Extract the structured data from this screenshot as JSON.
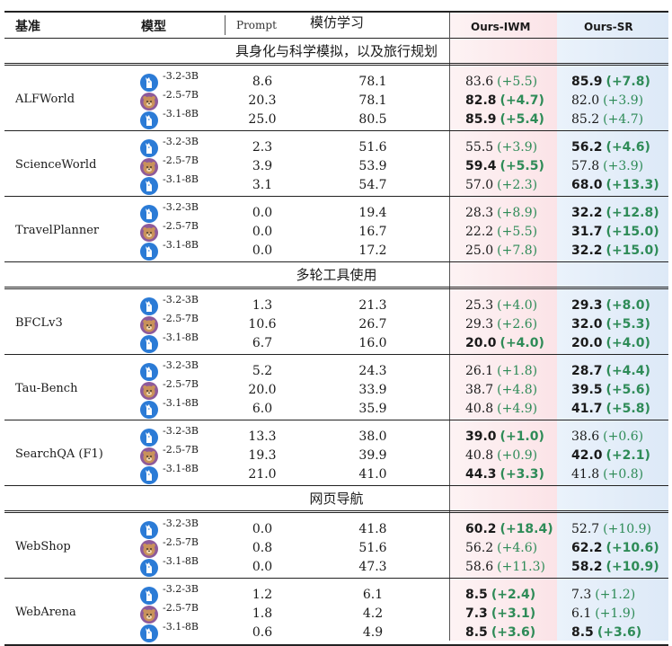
{
  "header": {
    "col_benchmark": "基准",
    "col_model": "模型",
    "col_prompt": "Prompt",
    "col_imitation": "模仿学习",
    "col_ours_iwm": "Ours-IWM",
    "col_ours_sr": "Ours-SR"
  },
  "colors": {
    "iwm_bg": "#fbe3e7",
    "sr_bg": "#dde9f7",
    "gain_text": "#2e8b57",
    "llama_icon": "#2b7bd6",
    "qwen_icon": "#8e5a9a"
  },
  "icons": {
    "llama": "llama-icon",
    "qwen": "bear-icon"
  },
  "sections": [
    {
      "title": "具身化与科学模拟，以及旅行规划",
      "benchmarks": [
        {
          "name": "ALFWorld",
          "rows": [
            {
              "model": "-3.2-3B",
              "icon": "llama",
              "prompt": "8.6",
              "imitation": "78.1",
              "iwm": "83.6",
              "iwm_gain": "(+5.5)",
              "iwm_bold": false,
              "sr": "85.9",
              "sr_gain": "(+7.8)",
              "sr_bold": true
            },
            {
              "model": "-2.5-7B",
              "icon": "qwen",
              "prompt": "20.3",
              "imitation": "78.1",
              "iwm": "82.8",
              "iwm_gain": "(+4.7)",
              "iwm_bold": true,
              "sr": "82.0",
              "sr_gain": "(+3.9)",
              "sr_bold": false
            },
            {
              "model": "-3.1-8B",
              "icon": "llama",
              "prompt": "25.0",
              "imitation": "80.5",
              "iwm": "85.9",
              "iwm_gain": "(+5.4)",
              "iwm_bold": true,
              "sr": "85.2",
              "sr_gain": "(+4.7)",
              "sr_bold": false
            }
          ]
        },
        {
          "name": "ScienceWorld",
          "rows": [
            {
              "model": "-3.2-3B",
              "icon": "llama",
              "prompt": "2.3",
              "imitation": "51.6",
              "iwm": "55.5",
              "iwm_gain": "(+3.9)",
              "iwm_bold": false,
              "sr": "56.2",
              "sr_gain": "(+4.6)",
              "sr_bold": true
            },
            {
              "model": "-2.5-7B",
              "icon": "qwen",
              "prompt": "3.9",
              "imitation": "53.9",
              "iwm": "59.4",
              "iwm_gain": "(+5.5)",
              "iwm_bold": true,
              "sr": "57.8",
              "sr_gain": "(+3.9)",
              "sr_bold": false
            },
            {
              "model": "-3.1-8B",
              "icon": "llama",
              "prompt": "3.1",
              "imitation": "54.7",
              "iwm": "57.0",
              "iwm_gain": "(+2.3)",
              "iwm_bold": false,
              "sr": "68.0",
              "sr_gain": "(+13.3)",
              "sr_bold": true
            }
          ]
        },
        {
          "name": "TravelPlanner",
          "rows": [
            {
              "model": "-3.2-3B",
              "icon": "llama",
              "prompt": "0.0",
              "imitation": "19.4",
              "iwm": "28.3",
              "iwm_gain": "(+8.9)",
              "iwm_bold": false,
              "sr": "32.2",
              "sr_gain": "(+12.8)",
              "sr_bold": true
            },
            {
              "model": "-2.5-7B",
              "icon": "qwen",
              "prompt": "0.0",
              "imitation": "16.7",
              "iwm": "22.2",
              "iwm_gain": "(+5.5)",
              "iwm_bold": false,
              "sr": "31.7",
              "sr_gain": "(+15.0)",
              "sr_bold": true
            },
            {
              "model": "-3.1-8B",
              "icon": "llama",
              "prompt": "0.0",
              "imitation": "17.2",
              "iwm": "25.0",
              "iwm_gain": "(+7.8)",
              "iwm_bold": false,
              "sr": "32.2",
              "sr_gain": "(+15.0)",
              "sr_bold": true
            }
          ]
        }
      ]
    },
    {
      "title": "多轮工具使用",
      "benchmarks": [
        {
          "name": "BFCLv3",
          "rows": [
            {
              "model": "-3.2-3B",
              "icon": "llama",
              "prompt": "1.3",
              "imitation": "21.3",
              "iwm": "25.3",
              "iwm_gain": "(+4.0)",
              "iwm_bold": false,
              "sr": "29.3",
              "sr_gain": "(+8.0)",
              "sr_bold": true
            },
            {
              "model": "-2.5-7B",
              "icon": "qwen",
              "prompt": "10.6",
              "imitation": "26.7",
              "iwm": "29.3",
              "iwm_gain": "(+2.6)",
              "iwm_bold": false,
              "sr": "32.0",
              "sr_gain": "(+5.3)",
              "sr_bold": true
            },
            {
              "model": "-3.1-8B",
              "icon": "llama",
              "prompt": "6.7",
              "imitation": "16.0",
              "iwm": "20.0",
              "iwm_gain": "(+4.0)",
              "iwm_bold": true,
              "sr": "20.0",
              "sr_gain": "(+4.0)",
              "sr_bold": true
            }
          ]
        },
        {
          "name": "Tau-Bench",
          "rows": [
            {
              "model": "-3.2-3B",
              "icon": "llama",
              "prompt": "5.2",
              "imitation": "24.3",
              "iwm": "26.1",
              "iwm_gain": "(+1.8)",
              "iwm_bold": false,
              "sr": "28.7",
              "sr_gain": "(+4.4)",
              "sr_bold": true
            },
            {
              "model": "-2.5-7B",
              "icon": "qwen",
              "prompt": "20.0",
              "imitation": "33.9",
              "iwm": "38.7",
              "iwm_gain": "(+4.8)",
              "iwm_bold": false,
              "sr": "39.5",
              "sr_gain": "(+5.6)",
              "sr_bold": true
            },
            {
              "model": "-3.1-8B",
              "icon": "llama",
              "prompt": "6.0",
              "imitation": "35.9",
              "iwm": "40.8",
              "iwm_gain": "(+4.9)",
              "iwm_bold": false,
              "sr": "41.7",
              "sr_gain": "(+5.8)",
              "sr_bold": true
            }
          ]
        },
        {
          "name": "SearchQA (F1)",
          "rows": [
            {
              "model": "-3.2-3B",
              "icon": "llama",
              "prompt": "13.3",
              "imitation": "38.0",
              "iwm": "39.0",
              "iwm_gain": "(+1.0)",
              "iwm_bold": true,
              "sr": "38.6",
              "sr_gain": "(+0.6)",
              "sr_bold": false
            },
            {
              "model": "-2.5-7B",
              "icon": "qwen",
              "prompt": "19.3",
              "imitation": "39.9",
              "iwm": "40.8",
              "iwm_gain": "(+0.9)",
              "iwm_bold": false,
              "sr": "42.0",
              "sr_gain": "(+2.1)",
              "sr_bold": true
            },
            {
              "model": "-3.1-8B",
              "icon": "llama",
              "prompt": "21.0",
              "imitation": "41.0",
              "iwm": "44.3",
              "iwm_gain": "(+3.3)",
              "iwm_bold": true,
              "sr": "41.8",
              "sr_gain": "(+0.8)",
              "sr_bold": false
            }
          ]
        }
      ]
    },
    {
      "title": "网页导航",
      "benchmarks": [
        {
          "name": "WebShop",
          "rows": [
            {
              "model": "-3.2-3B",
              "icon": "llama",
              "prompt": "0.0",
              "imitation": "41.8",
              "iwm": "60.2",
              "iwm_gain": "(+18.4)",
              "iwm_bold": true,
              "sr": "52.7",
              "sr_gain": "(+10.9)",
              "sr_bold": false
            },
            {
              "model": "-2.5-7B",
              "icon": "qwen",
              "prompt": "0.8",
              "imitation": "51.6",
              "iwm": "56.2",
              "iwm_gain": "(+4.6)",
              "iwm_bold": false,
              "sr": "62.2",
              "sr_gain": "(+10.6)",
              "sr_bold": true
            },
            {
              "model": "-3.1-8B",
              "icon": "llama",
              "prompt": "0.0",
              "imitation": "47.3",
              "iwm": "58.6",
              "iwm_gain": "(+11.3)",
              "iwm_bold": false,
              "sr": "58.2",
              "sr_gain": "(+10.9)",
              "sr_bold": true
            }
          ]
        },
        {
          "name": "WebArena",
          "rows": [
            {
              "model": "-3.2-3B",
              "icon": "llama",
              "prompt": "1.2",
              "imitation": "6.1",
              "iwm": "8.5",
              "iwm_gain": "(+2.4)",
              "iwm_bold": true,
              "sr": "7.3",
              "sr_gain": "(+1.2)",
              "sr_bold": false
            },
            {
              "model": "-2.5-7B",
              "icon": "qwen",
              "prompt": "1.8",
              "imitation": "4.2",
              "iwm": "7.3",
              "iwm_gain": "(+3.1)",
              "iwm_bold": true,
              "sr": "6.1",
              "sr_gain": "(+1.9)",
              "sr_bold": false
            },
            {
              "model": "-3.1-8B",
              "icon": "llama",
              "prompt": "0.6",
              "imitation": "4.9",
              "iwm": "8.5",
              "iwm_gain": "(+3.6)",
              "iwm_bold": true,
              "sr": "8.5",
              "sr_gain": "(+3.6)",
              "sr_bold": true
            }
          ]
        }
      ]
    }
  ]
}
